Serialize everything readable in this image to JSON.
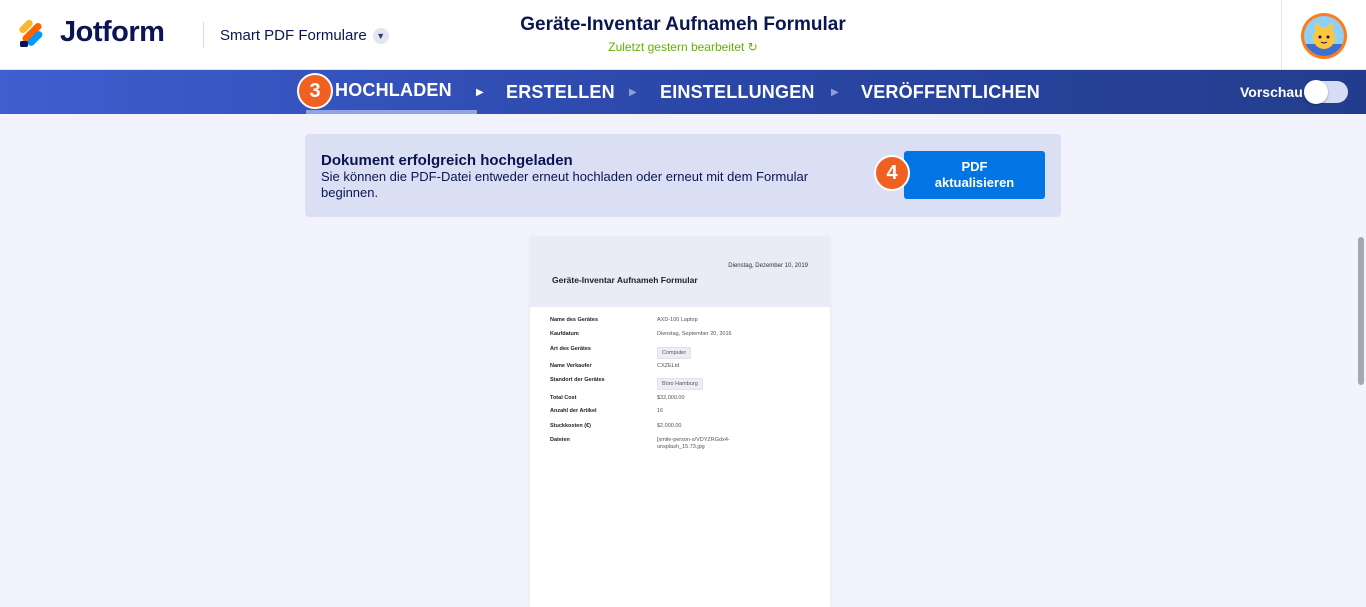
{
  "header": {
    "brand": "Jotform",
    "product": "Smart PDF Formulare",
    "form_title": "Geräte-Inventar Aufnameh Formular",
    "subtitle": "Zuletzt gestern bearbeitet"
  },
  "nav": {
    "tabs": [
      {
        "label": "HOCHLADEN",
        "active": true
      },
      {
        "label": "ERSTELLEN",
        "active": false
      },
      {
        "label": "EINSTELLUNGEN",
        "active": false
      },
      {
        "label": "VERÖFFENTLICHEN",
        "active": false
      }
    ],
    "step_badge": "3",
    "preview_label": "Vorschau"
  },
  "notice": {
    "title": "Dokument erfolgreich hochgeladen",
    "text": "Sie können die PDF-Datei entweder erneut hochladen oder erneut mit dem Formular beginnen.",
    "button_label": "PDF aktualisieren",
    "step_badge": "4"
  },
  "pdf": {
    "date": "Dienstag, Dezember 10, 2019",
    "title": "Geräte-Inventar Aufnameh Formular",
    "rows": [
      {
        "label": "Name des Gerätes",
        "value": "AXD-100 Laptop",
        "chip": false
      },
      {
        "label": "Kaufdatum",
        "value": "Dienstag, September 20, 2016",
        "chip": false
      },
      {
        "label": "Art des Gerätes",
        "value": "Computer",
        "chip": true
      },
      {
        "label": "Name Verkaufer",
        "value": "CXZELtd",
        "chip": false
      },
      {
        "label": "Standort der Gerätes",
        "value": "Büro Hamburg",
        "chip": true
      },
      {
        "label": "Total Cost",
        "value": "$32,000.00",
        "chip": false
      },
      {
        "label": "Anzahl der Artikel",
        "value": "16",
        "chip": false
      },
      {
        "label": "Stuckkosten (€)",
        "value": "$2,000.00",
        "chip": false
      },
      {
        "label": "Dateien",
        "value": "[smile-person-s/VDYZRGdx4-unsplash_15.73.jpg",
        "chip": false
      }
    ]
  },
  "colors": {
    "brand_navy": "#0a1551",
    "accent_blue": "#0075e3",
    "badge_orange": "#f06121",
    "subtitle_green": "#64b200"
  }
}
